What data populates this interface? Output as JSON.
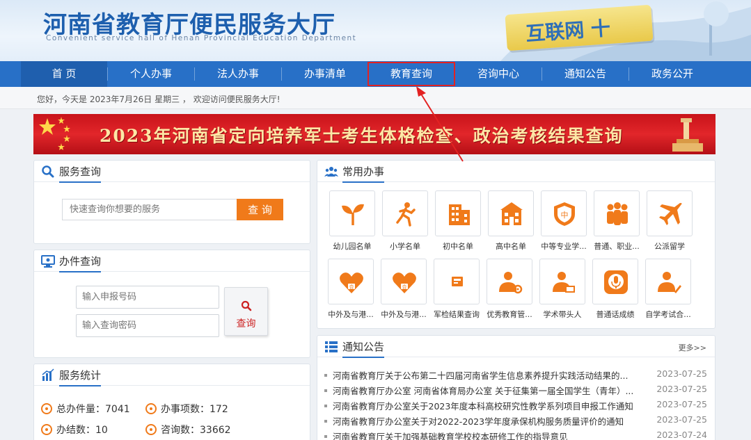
{
  "header": {
    "title": "河南省教育厅便民服务大厅",
    "subtitle": "Convenient service hall of Henan Provincial Education Department",
    "badge": "互联网 十"
  },
  "nav": {
    "items": [
      "首 页",
      "个人办事",
      "法人办事",
      "办事清单",
      "教育查询",
      "咨询中心",
      "通知公告",
      "政务公开"
    ]
  },
  "greeting": "您好，今天是 2023年7月26日 星期三 ， 欢迎访问便民服务大厅!",
  "banner": "2023年河南省定向培养军士考生体格检查、政治考核结果查询",
  "service_search": {
    "title": "服务查询",
    "placeholder": "快速查询你想要的服务",
    "button": "查 询"
  },
  "case_query": {
    "title": "办件查询",
    "code_placeholder": "输入申报号码",
    "password_placeholder": "输入查询密码",
    "button": "查询"
  },
  "stats": {
    "title": "服务统计",
    "total": "总办件量：7041",
    "items": "办事项数：172",
    "done": "办结数：10",
    "consult": "咨询数：33662"
  },
  "common": {
    "title": "常用办事",
    "tiles": [
      "幼儿园名单",
      "小学名单",
      "初中名单",
      "高中名单",
      "中等专业学...",
      "普通、职业...",
      "公派留学",
      "中外及与港...",
      "中外及与港...",
      "军检结果查询",
      "优秀教育管...",
      "学术带头人",
      "普通话成绩",
      "自学考试合..."
    ]
  },
  "notice": {
    "title": "通知公告",
    "more": "更多>>",
    "list": [
      {
        "title": "河南省教育厅关于公布第二十四届河南省学生信息素养提升实践活动结果的...",
        "date": "2023-07-25"
      },
      {
        "title": "河南省教育厅办公室 河南省体育局办公室 关于征集第一届全国学生（青年）...",
        "date": "2023-07-25"
      },
      {
        "title": "河南省教育厅办公室关于2023年度本科高校研究性教学系列项目申报工作通知",
        "date": "2023-07-25"
      },
      {
        "title": "河南省教育厅办公室关于对2022-2023学年度承保机构服务质量评价的通知",
        "date": "2023-07-25"
      },
      {
        "title": "河南省教育厅关于加强基础教育学校校本研修工作的指导意见",
        "date": "2023-07-24"
      }
    ]
  },
  "colors": {
    "nav": "#2870c7",
    "accent": "#f07a1a",
    "highlight": "#e32222"
  }
}
